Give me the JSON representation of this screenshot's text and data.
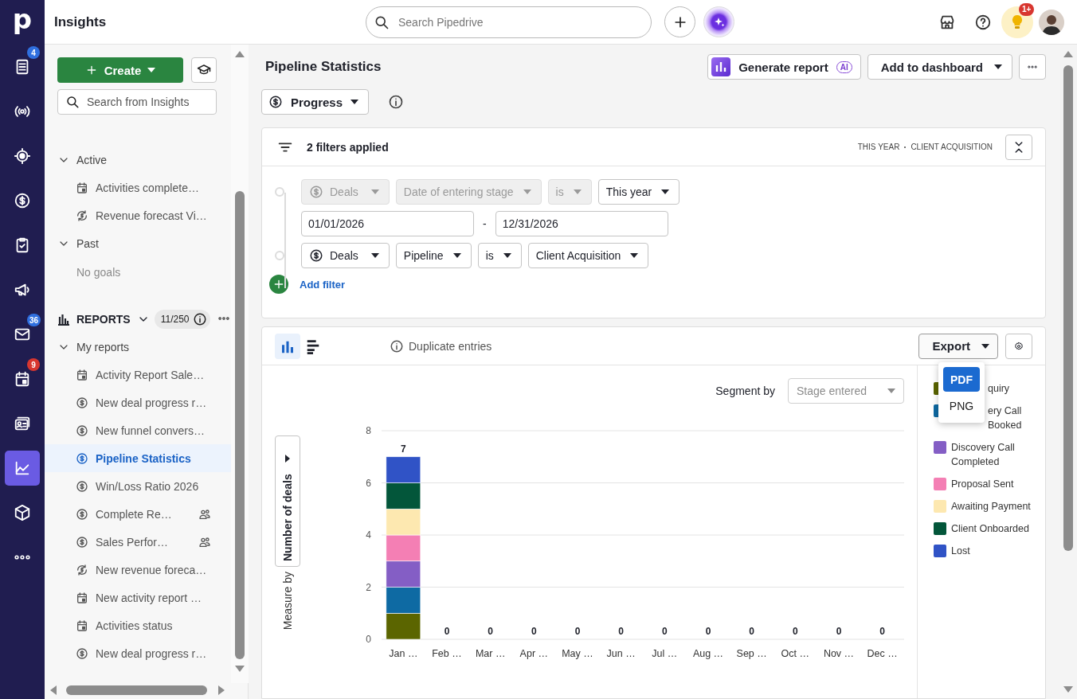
{
  "nav_rail": {
    "logo": "p",
    "items": [
      {
        "kind": "list",
        "selected": false,
        "badge": "4",
        "color": "#2f6fdf"
      },
      {
        "kind": "signal",
        "selected": false
      },
      {
        "kind": "target",
        "selected": false
      },
      {
        "kind": "dollar",
        "selected": false
      },
      {
        "kind": "clipboard",
        "selected": false
      },
      {
        "kind": "megaphone",
        "selected": false
      },
      {
        "kind": "mail",
        "selected": false,
        "badge": "36",
        "color": "#2f6fdf"
      },
      {
        "kind": "calendar",
        "selected": false,
        "badge": "9",
        "color": "#d8362f"
      },
      {
        "kind": "contacts",
        "selected": false
      },
      {
        "kind": "chart",
        "selected": true
      },
      {
        "kind": "box",
        "selected": false
      },
      {
        "kind": "more",
        "selected": false
      }
    ]
  },
  "top_bar": {
    "title": "Insights",
    "search": {
      "placeholder": "Search Pipedrive"
    },
    "notifications_badge": "1+"
  },
  "sidebar": {
    "create_label": "Create",
    "search": {
      "placeholder": "Search from Insights"
    },
    "goals": [
      {
        "label": "Active",
        "expanded": true,
        "children": [
          {
            "label": "Activities complete…",
            "kind": "calendar",
            "selected": false
          },
          {
            "label": "Revenue forecast Vi…",
            "kind": "forecast",
            "selected": false
          }
        ]
      },
      {
        "label": "Past",
        "expanded": true,
        "empty_text": "No goals"
      }
    ],
    "reports": {
      "label": "REPORTS",
      "expanded": true,
      "count": "11/250",
      "groups": [
        {
          "label": "My reports",
          "expanded": true,
          "children": [
            {
              "label": "Activity Report Sale…",
              "kind": "calendar",
              "selected": false,
              "shared": false
            },
            {
              "label": "New deal progress r…",
              "kind": "dollar",
              "selected": false,
              "shared": false
            },
            {
              "label": "New funnel convers…",
              "kind": "dollar",
              "selected": false,
              "shared": false
            },
            {
              "label": "Pipeline Statistics",
              "kind": "dollar",
              "selected": true,
              "shared": false
            },
            {
              "label": "Win/Loss Ratio 2026",
              "kind": "dollar",
              "selected": false,
              "shared": false
            },
            {
              "label": "Complete Re…",
              "kind": "dollar",
              "selected": false,
              "shared": true
            },
            {
              "label": "Sales Perfor…",
              "kind": "dollar",
              "selected": false,
              "shared": true
            },
            {
              "label": "New revenue foreca…",
              "kind": "forecast",
              "selected": false,
              "shared": false
            },
            {
              "label": "New activity report …",
              "kind": "calendar",
              "selected": false,
              "shared": false
            },
            {
              "label": "Activities status",
              "kind": "calendar",
              "selected": false,
              "shared": false
            },
            {
              "label": "New deal progress r…",
              "kind": "dollar",
              "selected": false,
              "shared": false
            }
          ]
        }
      ]
    }
  },
  "report": {
    "title": "Pipeline Statistics",
    "generate": {
      "label": "Generate report",
      "badge": "AI"
    },
    "add_to_dashboard": "Add to dashboard",
    "view_dropdown": "Progress",
    "filters": {
      "summary": "2 filters applied",
      "tags": [
        "THIS YEAR",
        "CLIENT ACQUISITION"
      ],
      "add_label": "Add filter",
      "rows": [
        {
          "fields": [
            {
              "kind": "entity",
              "value": "Deals",
              "disabled": true
            },
            {
              "kind": "field",
              "value": "Date of entering stage",
              "disabled": true
            },
            {
              "kind": "field",
              "value": "is",
              "disabled": true
            },
            {
              "kind": "field",
              "value": "This year",
              "disabled": false
            }
          ],
          "range": {
            "from": "01/01/2026",
            "separator": "-",
            "to": "12/31/2026"
          }
        },
        {
          "fields": [
            {
              "kind": "entity",
              "value": "Deals",
              "disabled": false
            },
            {
              "kind": "field",
              "value": "Pipeline",
              "disabled": false
            },
            {
              "kind": "field",
              "value": "is",
              "disabled": false
            },
            {
              "kind": "field",
              "value": "Client Acquisition",
              "disabled": false
            }
          ]
        }
      ]
    },
    "chart_panel": {
      "views": [
        {
          "kind": "column",
          "selected": true
        },
        {
          "kind": "bar",
          "selected": false
        }
      ],
      "notice": "Duplicate entries",
      "export": {
        "label": "Export",
        "expanded": true,
        "options": [
          {
            "label": "PDF",
            "selected": true
          },
          {
            "label": "PNG",
            "selected": false
          }
        ]
      },
      "segment_by": {
        "label": "Segment by",
        "value": "Stage entered",
        "disabled": true
      },
      "measure_by": {
        "label": "Measure by",
        "value": "Number of deals"
      },
      "chart_data": {
        "type": "bar",
        "stacked": true,
        "categories": [
          "Jan …",
          "Feb …",
          "Mar …",
          "Apr …",
          "May …",
          "Jun …",
          "Jul …",
          "Aug …",
          "Sep …",
          "Oct …",
          "Nov …",
          "Dec …"
        ],
        "ylim": [
          0,
          8
        ],
        "yticks": [
          0,
          2,
          4,
          6,
          8
        ],
        "grid": true,
        "value_labels": [
          "7",
          "0",
          "0",
          "0",
          "0",
          "0",
          "0",
          "0",
          "0",
          "0",
          "0",
          "0"
        ],
        "series": [
          {
            "name": "quiry",
            "color": "#5b6500",
            "values": [
              1,
              0,
              0,
              0,
              0,
              0,
              0,
              0,
              0,
              0,
              0,
              0
            ]
          },
          {
            "name": "ery Call Booked",
            "color": "#0e6aa3",
            "values": [
              1,
              0,
              0,
              0,
              0,
              0,
              0,
              0,
              0,
              0,
              0,
              0
            ]
          },
          {
            "name": "Discovery Call Completed",
            "color": "#845ec5",
            "values": [
              1,
              0,
              0,
              0,
              0,
              0,
              0,
              0,
              0,
              0,
              0,
              0
            ]
          },
          {
            "name": "Proposal Sent",
            "color": "#f47fb4",
            "values": [
              1,
              0,
              0,
              0,
              0,
              0,
              0,
              0,
              0,
              0,
              0,
              0
            ]
          },
          {
            "name": "Awaiting Payment",
            "color": "#fde8b0",
            "values": [
              1,
              0,
              0,
              0,
              0,
              0,
              0,
              0,
              0,
              0,
              0,
              0
            ]
          },
          {
            "name": "Client Onboarded",
            "color": "#03563a",
            "values": [
              1,
              0,
              0,
              0,
              0,
              0,
              0,
              0,
              0,
              0,
              0,
              0
            ]
          },
          {
            "name": "Lost",
            "color": "#3053c6",
            "values": [
              1,
              0,
              0,
              0,
              0,
              0,
              0,
              0,
              0,
              0,
              0,
              0
            ]
          }
        ]
      }
    }
  }
}
